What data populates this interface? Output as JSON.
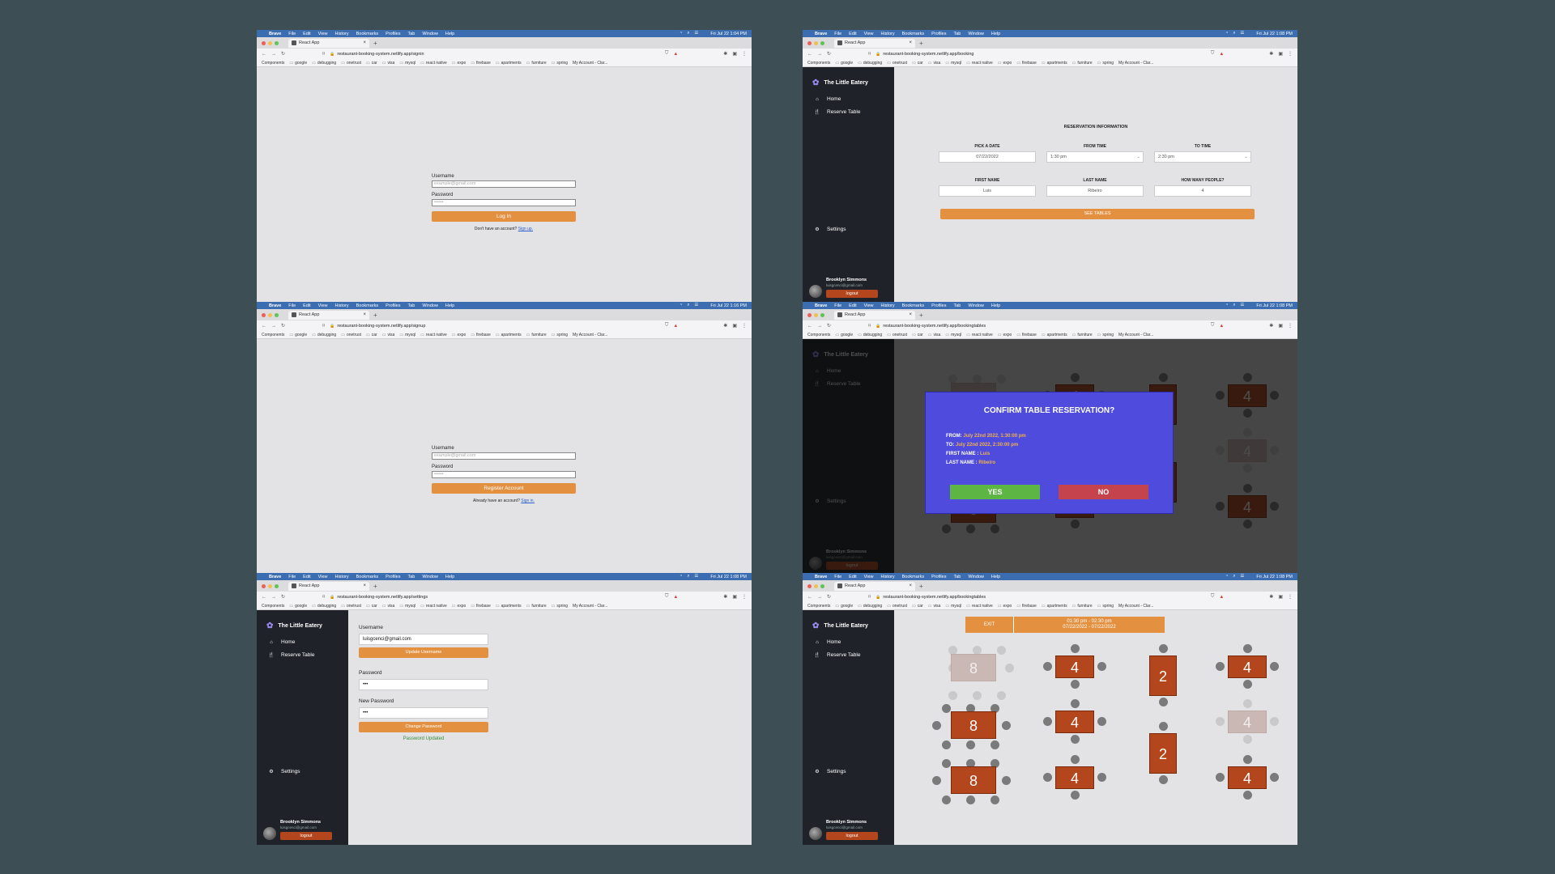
{
  "browser": {
    "app_name": "Brave",
    "menus": [
      "File",
      "Edit",
      "View",
      "History",
      "Bookmarks",
      "Profiles",
      "Tab",
      "Window",
      "Help"
    ],
    "tab_title": "React App",
    "bookmarks": [
      "Components",
      "google",
      "debugging",
      "onetrust",
      "car",
      "visa",
      "mysql",
      "react native",
      "expo",
      "firebase",
      "apartments",
      "furniture",
      "spring",
      "My Account - Clar..."
    ]
  },
  "shots": {
    "signin": {
      "clock": "Fri Jul 22  1:04 PM",
      "url": "restaurant-booking-system.netlify.app/signin",
      "username_label": "Username",
      "username_placeholder": "example@gmail.com",
      "password_label": "Password",
      "password_value": "••••••",
      "button": "Log In",
      "footer_text": "Don't have an account?",
      "footer_link": "Sign up."
    },
    "signup": {
      "clock": "Fri Jul 22  1:16 PM",
      "url": "restaurant-booking-system.netlify.app/signup",
      "username_label": "Username",
      "username_placeholder": "example@gmail.com",
      "password_label": "Password",
      "password_value": "••••••",
      "button": "Register Account",
      "footer_text": "Already have an account?",
      "footer_link": "Sign in."
    },
    "settings": {
      "clock": "Fri Jul 22  1:08 PM",
      "url": "restaurant-booking-system.netlify.app/settings",
      "username_label": "Username",
      "username_value": "luisgcenci@gmail.com",
      "update_button": "Update Username",
      "password_label": "Password",
      "password_value": "•••",
      "new_password_label": "New Password",
      "new_password_value": "•••",
      "change_button": "Change Password",
      "status": "Password Updated"
    },
    "booking": {
      "clock": "Fri Jul 22  1:08 PM",
      "url": "restaurant-booking-system.netlify.app/booking",
      "title": "RESERVATION INFORMATION",
      "date_label": "PICK A DATE",
      "date_value": "07/22/2022",
      "from_label": "FROM TIME",
      "from_value": "1:30 pm",
      "to_label": "TO TIME",
      "to_value": "2:30 pm",
      "first_label": "FIRST NAME",
      "first_value": "Luis",
      "last_label": "LAST NAME",
      "last_value": "Ribeiro",
      "people_label": "HOW MANY PEOPLE?",
      "people_value": "4",
      "button": "SEE TABLES"
    },
    "modal": {
      "clock": "Fri Jul 22  1:08 PM",
      "url": "restaurant-booking-system.netlify.app/bookingtables",
      "exit_label": "EXIT",
      "range_time": "01:30 pm - 02:30 pm",
      "range_date": "07/22/2022 - 07/22/2022",
      "title": "CONFIRM TABLE RESERVATION?",
      "from_label": "FROM:",
      "from_value": "July 22nd 2022, 1:30:00 pm",
      "to_label": "TO:",
      "to_value": "July 22nd 2022, 2:30:00 pm",
      "first_label": "FIRST NAME :",
      "first_value": "Luis",
      "last_label": "LAST NAME :",
      "last_value": "Ribeiro",
      "yes": "YES",
      "no": "NO"
    },
    "tables": {
      "clock": "Fri Jul 22  1:08 PM",
      "url": "restaurant-booking-system.netlify.app/bookingtables",
      "exit_label": "EXIT",
      "range_time": "01:30 pm - 02:30 pm",
      "range_date": "07/22/2022 - 07/22/2022"
    }
  },
  "sidebar": {
    "brand": "The Little Eatery",
    "home": "Home",
    "reserve": "Reserve Table",
    "settings": "Settings",
    "user_name": "Brooklyn Simmons",
    "user_email": "luisgcenci@gmail.com",
    "logout": "logout"
  },
  "floor_tables": {
    "seats": [
      "8",
      "4",
      "2",
      "4",
      "8",
      "4",
      "2",
      "4",
      "8",
      "4",
      "4"
    ],
    "available": [
      false,
      true,
      true,
      true,
      true,
      true,
      true,
      false,
      true,
      true,
      true
    ]
  },
  "colors": {
    "accent": "#e39140",
    "brand_dark": "#1f2329",
    "table": "#b3461c",
    "modal": "#4f4bdc",
    "yes": "#5db543",
    "no": "#c4434d",
    "mac_bar": "#3b6db0"
  }
}
